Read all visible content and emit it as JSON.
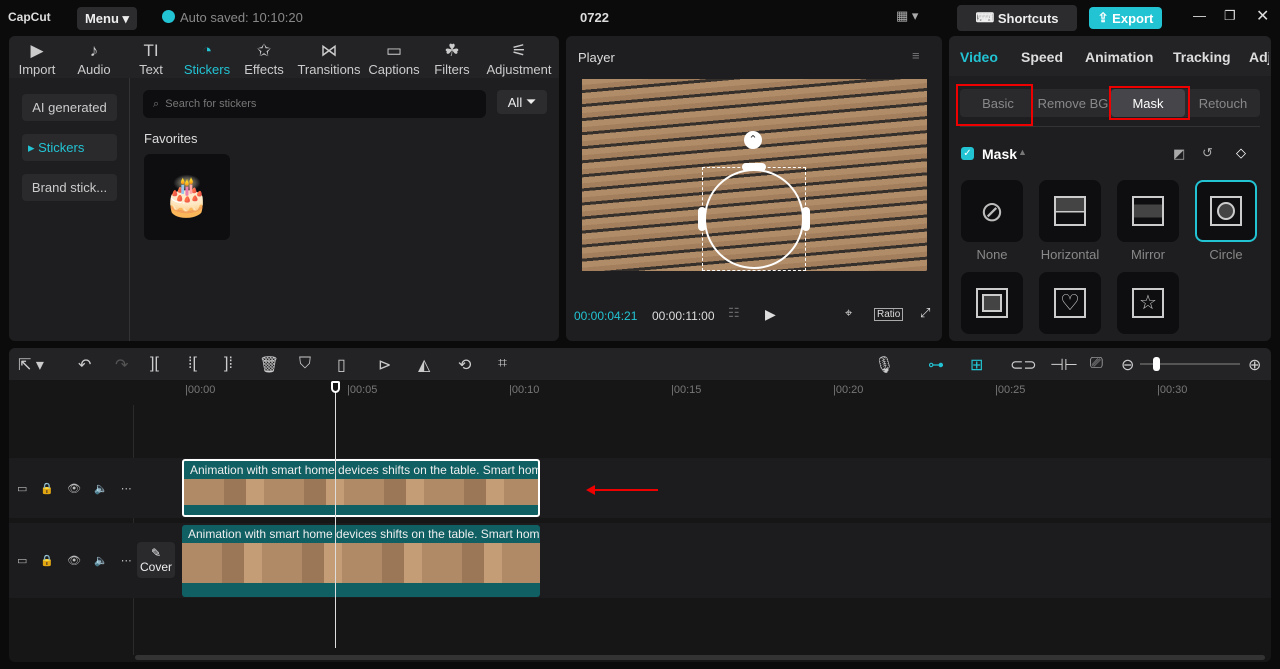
{
  "app": {
    "logo": "CapCut",
    "menu": "Menu",
    "autosave": "Auto saved: 10:10:20",
    "project": "0722",
    "shortcuts": "Shortcuts",
    "export": "Export"
  },
  "tools": [
    "Import",
    "Audio",
    "Text",
    "Stickers",
    "Effects",
    "Transitions",
    "Captions",
    "Filters",
    "Adjustment"
  ],
  "sidebar": [
    "AI generated",
    "Stickers",
    "Brand stick..."
  ],
  "stickers": {
    "search_placeholder": "Search for stickers",
    "filter": "All",
    "section": "Favorites"
  },
  "player": {
    "title": "Player",
    "current": "00:00:04:21",
    "total": "00:00:11:00",
    "ratio": "Ratio"
  },
  "right": {
    "tabs": [
      "Video",
      "Speed",
      "Animation",
      "Tracking",
      "Adj"
    ],
    "subtabs": [
      "Basic",
      "Remove BG",
      "Mask",
      "Retouch"
    ],
    "section": "Mask",
    "masks": [
      "None",
      "Horizontal",
      "Mirror",
      "Circle"
    ]
  },
  "timeline": {
    "ticks": [
      "00:00",
      "00:05",
      "00:10",
      "00:15",
      "00:20",
      "00:25",
      "00:30"
    ],
    "clip_text": "Animation with smart home devices shifts on the table. Smart home",
    "cover": "Cover"
  },
  "colors": {
    "accent": "#22c3d3",
    "highlight": "#ee0000"
  }
}
